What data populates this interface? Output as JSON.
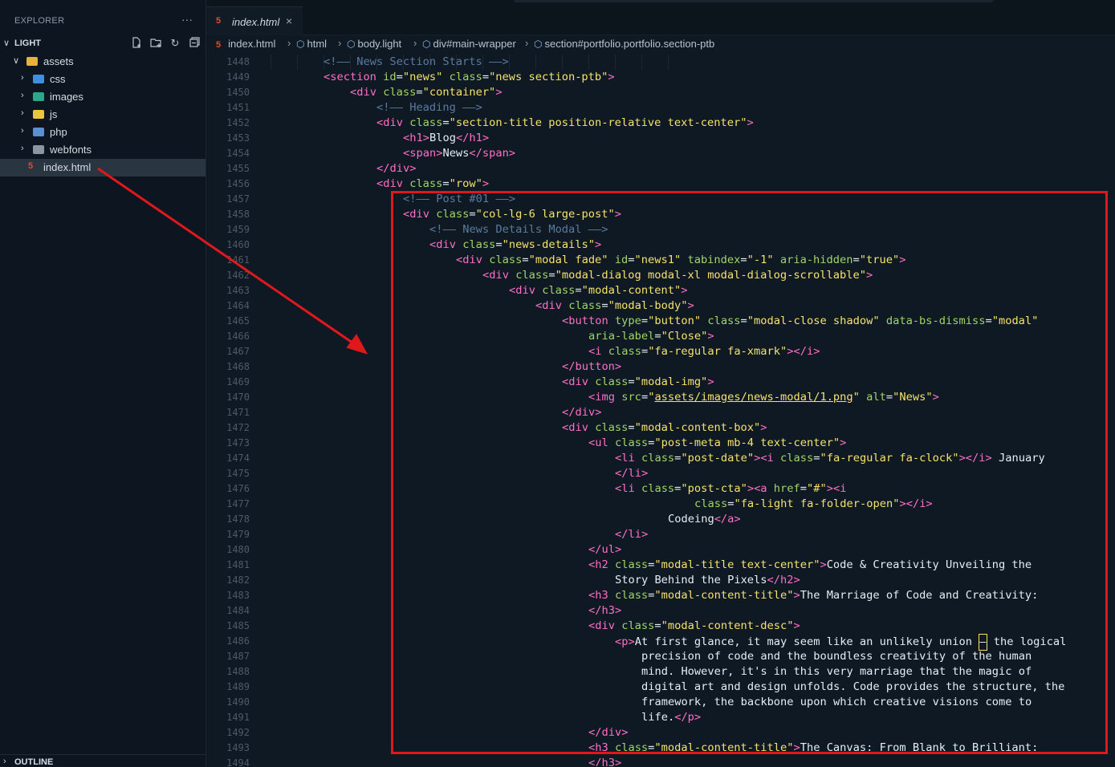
{
  "sidebar": {
    "title": "EXPLORER",
    "more": "···",
    "section": "LIGHT",
    "tools": [
      "new-file-icon",
      "new-folder-icon",
      "refresh-icon",
      "collapse-all-icon"
    ],
    "tree": {
      "assets": "assets",
      "css": "css",
      "images": "images",
      "js": "js",
      "php": "php",
      "webfonts": "webfonts",
      "index": "index.html"
    },
    "outline": "OUTLINE"
  },
  "tabs": [
    {
      "label": "index.html",
      "close": "×"
    }
  ],
  "breadcrumb": [
    "index.html",
    "html",
    "body.light",
    "div#main-wrapper",
    "section#portfolio.portfolio.section-ptb"
  ],
  "editor": {
    "line_numbers": [
      "1448",
      "1449",
      "1450",
      "1451",
      "1452",
      "1453",
      "1454",
      "1455",
      "1456",
      "1457",
      "1458",
      "1459",
      "1460",
      "1461",
      "1462",
      "1463",
      "1464",
      "1465",
      "1466",
      "1467",
      "1468",
      "1469",
      "1470",
      "1471",
      "1472",
      "1473",
      "1474",
      "1475",
      "1476",
      "1477",
      "1478",
      "1479",
      "1480",
      "1481",
      "1482",
      "1483",
      "1484",
      "1485",
      "1486",
      "1487",
      "1488",
      "1489",
      "1490",
      "1491",
      "1492",
      "1493",
      "1494"
    ],
    "lines": [
      {
        "indent": 2,
        "tokens": [
          [
            "cmt",
            "<!—— News Section Starts ——>"
          ]
        ]
      },
      {
        "indent": 2,
        "tokens": [
          [
            "tag",
            "<section "
          ],
          [
            "attr",
            "id"
          ],
          [
            "txt",
            "="
          ],
          [
            "str",
            "\"news\""
          ],
          [
            "attr",
            " class"
          ],
          [
            "txt",
            "="
          ],
          [
            "str",
            "\"news section-ptb\""
          ],
          [
            "tag",
            ">"
          ]
        ]
      },
      {
        "indent": 3,
        "tokens": [
          [
            "tag",
            "<div "
          ],
          [
            "attr",
            "class"
          ],
          [
            "txt",
            "="
          ],
          [
            "str",
            "\"container\""
          ],
          [
            "tag",
            ">"
          ]
        ]
      },
      {
        "indent": 4,
        "tokens": [
          [
            "cmt",
            "<!—— Heading ——>"
          ]
        ]
      },
      {
        "indent": 4,
        "tokens": [
          [
            "tag",
            "<div "
          ],
          [
            "attr",
            "class"
          ],
          [
            "txt",
            "="
          ],
          [
            "str",
            "\"section-title position-relative text-center\""
          ],
          [
            "tag",
            ">"
          ]
        ]
      },
      {
        "indent": 5,
        "tokens": [
          [
            "tag",
            "<h1>"
          ],
          [
            "txt",
            "Blog"
          ],
          [
            "tag",
            "</h1>"
          ]
        ]
      },
      {
        "indent": 5,
        "tokens": [
          [
            "tag",
            "<span>"
          ],
          [
            "txt",
            "News"
          ],
          [
            "tag",
            "</span>"
          ]
        ]
      },
      {
        "indent": 4,
        "tokens": [
          [
            "tag",
            "</div>"
          ]
        ]
      },
      {
        "indent": 4,
        "tokens": [
          [
            "tag",
            "<div "
          ],
          [
            "attr",
            "class"
          ],
          [
            "txt",
            "="
          ],
          [
            "str",
            "\"row\""
          ],
          [
            "tag",
            ">"
          ]
        ]
      },
      {
        "indent": 5,
        "tokens": [
          [
            "cmt",
            "<!—— Post #01 ——>"
          ]
        ]
      },
      {
        "indent": 5,
        "tokens": [
          [
            "tag",
            "<div "
          ],
          [
            "attr",
            "class"
          ],
          [
            "txt",
            "="
          ],
          [
            "str",
            "\"col-lg-6 large-post\""
          ],
          [
            "tag",
            ">"
          ]
        ]
      },
      {
        "indent": 6,
        "tokens": [
          [
            "cmt",
            "<!—— News Details Modal ——>"
          ]
        ]
      },
      {
        "indent": 6,
        "tokens": [
          [
            "tag",
            "<div "
          ],
          [
            "attr",
            "class"
          ],
          [
            "txt",
            "="
          ],
          [
            "str",
            "\"news-details\""
          ],
          [
            "tag",
            ">"
          ]
        ]
      },
      {
        "indent": 7,
        "tokens": [
          [
            "tag",
            "<div "
          ],
          [
            "attr",
            "class"
          ],
          [
            "txt",
            "="
          ],
          [
            "str",
            "\"modal fade\""
          ],
          [
            "attr",
            " id"
          ],
          [
            "txt",
            "="
          ],
          [
            "str",
            "\"news1\""
          ],
          [
            "attr",
            " tabindex"
          ],
          [
            "txt",
            "="
          ],
          [
            "str",
            "\"-1\""
          ],
          [
            "attr",
            " aria-hidden"
          ],
          [
            "txt",
            "="
          ],
          [
            "str",
            "\"true\""
          ],
          [
            "tag",
            ">"
          ]
        ]
      },
      {
        "indent": 8,
        "tokens": [
          [
            "tag",
            "<div "
          ],
          [
            "attr",
            "class"
          ],
          [
            "txt",
            "="
          ],
          [
            "str",
            "\"modal-dialog modal-xl modal-dialog-scrollable\""
          ],
          [
            "tag",
            ">"
          ]
        ]
      },
      {
        "indent": 9,
        "tokens": [
          [
            "tag",
            "<div "
          ],
          [
            "attr",
            "class"
          ],
          [
            "txt",
            "="
          ],
          [
            "str",
            "\"modal-content\""
          ],
          [
            "tag",
            ">"
          ]
        ]
      },
      {
        "indent": 10,
        "tokens": [
          [
            "tag",
            "<div "
          ],
          [
            "attr",
            "class"
          ],
          [
            "txt",
            "="
          ],
          [
            "str",
            "\"modal-body\""
          ],
          [
            "tag",
            ">"
          ]
        ]
      },
      {
        "indent": 11,
        "tokens": [
          [
            "tag",
            "<button "
          ],
          [
            "attr",
            "type"
          ],
          [
            "txt",
            "="
          ],
          [
            "str",
            "\"button\""
          ],
          [
            "attr",
            " class"
          ],
          [
            "txt",
            "="
          ],
          [
            "str",
            "\"modal-close shadow\""
          ],
          [
            "attr",
            " data-bs-dismiss"
          ],
          [
            "txt",
            "="
          ],
          [
            "str",
            "\"modal\""
          ]
        ]
      },
      {
        "indent": 12,
        "tokens": [
          [
            "attr",
            "aria-label"
          ],
          [
            "txt",
            "="
          ],
          [
            "str",
            "\"Close\""
          ],
          [
            "tag",
            ">"
          ]
        ]
      },
      {
        "indent": 12,
        "tokens": [
          [
            "tag",
            "<i "
          ],
          [
            "attr",
            "class"
          ],
          [
            "txt",
            "="
          ],
          [
            "str",
            "\"fa-regular fa-xmark\""
          ],
          [
            "tag",
            "></i>"
          ]
        ]
      },
      {
        "indent": 11,
        "tokens": [
          [
            "tag",
            "</button>"
          ]
        ]
      },
      {
        "indent": 11,
        "tokens": [
          [
            "tag",
            "<div "
          ],
          [
            "attr",
            "class"
          ],
          [
            "txt",
            "="
          ],
          [
            "str",
            "\"modal-img\""
          ],
          [
            "tag",
            ">"
          ]
        ]
      },
      {
        "indent": 12,
        "tokens": [
          [
            "tag",
            "<img "
          ],
          [
            "attr",
            "src"
          ],
          [
            "txt",
            "="
          ],
          [
            "str",
            "\""
          ],
          [
            "link",
            "assets/images/news-modal/1.png"
          ],
          [
            "str",
            "\""
          ],
          [
            "attr",
            " alt"
          ],
          [
            "txt",
            "="
          ],
          [
            "str",
            "\"News\""
          ],
          [
            "tag",
            ">"
          ]
        ]
      },
      {
        "indent": 11,
        "tokens": [
          [
            "tag",
            "</div>"
          ]
        ]
      },
      {
        "indent": 11,
        "tokens": [
          [
            "tag",
            "<div "
          ],
          [
            "attr",
            "class"
          ],
          [
            "txt",
            "="
          ],
          [
            "str",
            "\"modal-content-box\""
          ],
          [
            "tag",
            ">"
          ]
        ]
      },
      {
        "indent": 12,
        "tokens": [
          [
            "tag",
            "<ul "
          ],
          [
            "attr",
            "class"
          ],
          [
            "txt",
            "="
          ],
          [
            "str",
            "\"post-meta mb-4 text-center\""
          ],
          [
            "tag",
            ">"
          ]
        ]
      },
      {
        "indent": 13,
        "tokens": [
          [
            "tag",
            "<li "
          ],
          [
            "attr",
            "class"
          ],
          [
            "txt",
            "="
          ],
          [
            "str",
            "\"post-date\""
          ],
          [
            "tag",
            "><i "
          ],
          [
            "attr",
            "class"
          ],
          [
            "txt",
            "="
          ],
          [
            "str",
            "\"fa-regular fa-clock\""
          ],
          [
            "tag",
            "></i>"
          ],
          [
            "txt",
            " January"
          ]
        ]
      },
      {
        "indent": 13,
        "tokens": [
          [
            "tag",
            "</li>"
          ]
        ]
      },
      {
        "indent": 13,
        "tokens": [
          [
            "tag",
            "<li "
          ],
          [
            "attr",
            "class"
          ],
          [
            "txt",
            "="
          ],
          [
            "str",
            "\"post-cta\""
          ],
          [
            "tag",
            "><a "
          ],
          [
            "attr",
            "href"
          ],
          [
            "txt",
            "="
          ],
          [
            "str",
            "\"#\""
          ],
          [
            "tag",
            "><i"
          ]
        ]
      },
      {
        "indent": 16,
        "tokens": [
          [
            "attr",
            "class"
          ],
          [
            "txt",
            "="
          ],
          [
            "str",
            "\"fa-light fa-folder-open\""
          ],
          [
            "tag",
            "></i>"
          ]
        ]
      },
      {
        "indent": 15,
        "tokens": [
          [
            "txt",
            "Codeing"
          ],
          [
            "tag",
            "</a>"
          ]
        ]
      },
      {
        "indent": 13,
        "tokens": [
          [
            "tag",
            "</li>"
          ]
        ]
      },
      {
        "indent": 12,
        "tokens": [
          [
            "tag",
            "</ul>"
          ]
        ]
      },
      {
        "indent": 12,
        "tokens": [
          [
            "tag",
            "<h2 "
          ],
          [
            "attr",
            "class"
          ],
          [
            "txt",
            "="
          ],
          [
            "str",
            "\"modal-title text-center\""
          ],
          [
            "tag",
            ">"
          ],
          [
            "txt",
            "Code & Creativity Unveiling the"
          ]
        ]
      },
      {
        "indent": 13,
        "tokens": [
          [
            "txt",
            "Story Behind the Pixels"
          ],
          [
            "tag",
            "</h2>"
          ]
        ]
      },
      {
        "indent": 12,
        "tokens": [
          [
            "tag",
            "<h3 "
          ],
          [
            "attr",
            "class"
          ],
          [
            "txt",
            "="
          ],
          [
            "str",
            "\"modal-content-title\""
          ],
          [
            "tag",
            ">"
          ],
          [
            "txt",
            "The Marriage of Code and Creativity:"
          ]
        ]
      },
      {
        "indent": 12,
        "tokens": [
          [
            "tag",
            "</h3>"
          ]
        ]
      },
      {
        "indent": 12,
        "tokens": [
          [
            "tag",
            "<div "
          ],
          [
            "attr",
            "class"
          ],
          [
            "txt",
            "="
          ],
          [
            "str",
            "\"modal-content-desc\""
          ],
          [
            "tag",
            ">"
          ]
        ]
      },
      {
        "indent": 13,
        "tokens": [
          [
            "tag",
            "<p>"
          ],
          [
            "txt",
            "At first glance, it may seem like an unlikely union "
          ],
          [
            "cursor",
            "—"
          ],
          [
            "txt",
            " the logical"
          ]
        ]
      },
      {
        "indent": 14,
        "tokens": [
          [
            "txt",
            "precision of code and the boundless creativity of the human"
          ]
        ]
      },
      {
        "indent": 14,
        "tokens": [
          [
            "txt",
            "mind. However, it's in this very marriage that the magic of"
          ]
        ]
      },
      {
        "indent": 14,
        "tokens": [
          [
            "txt",
            "digital art and design unfolds. Code provides the structure, the"
          ]
        ]
      },
      {
        "indent": 14,
        "tokens": [
          [
            "txt",
            "framework, the backbone upon which creative visions come to"
          ]
        ]
      },
      {
        "indent": 14,
        "tokens": [
          [
            "txt",
            "life."
          ],
          [
            "tag",
            "</p>"
          ]
        ]
      },
      {
        "indent": 12,
        "tokens": [
          [
            "tag",
            "</div>"
          ]
        ]
      },
      {
        "indent": 12,
        "tokens": [
          [
            "tag",
            "<h3 "
          ],
          [
            "attr",
            "class"
          ],
          [
            "txt",
            "="
          ],
          [
            "str",
            "\"modal-content-title\""
          ],
          [
            "tag",
            ">"
          ],
          [
            "txt",
            "The Canvas: From Blank to Brilliant:"
          ]
        ]
      },
      {
        "indent": 12,
        "tokens": [
          [
            "tag",
            "</h3>"
          ]
        ]
      }
    ]
  },
  "annotation": {
    "box_color": "#e0181c",
    "arrow_color": "#e0181c"
  }
}
